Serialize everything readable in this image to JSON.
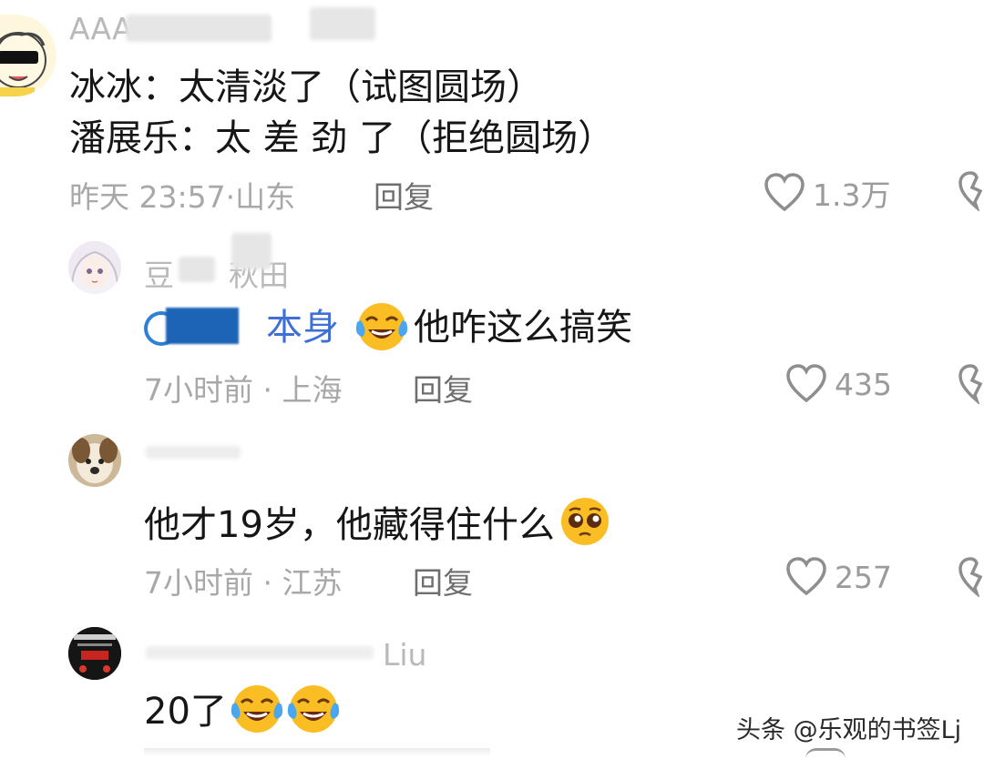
{
  "comments": [
    {
      "username": "AAA",
      "lines": [
        "冰冰：太清淡了（试图圆场）",
        "潘展乐：太 差 劲 了（拒绝圆场）"
      ],
      "time": "昨天 23:57",
      "location": "山东",
      "reply_label": "回复",
      "likes": "1.3万"
    },
    {
      "username": "豆",
      "username_tail": "秋田",
      "mention": "本身",
      "text": "他咋这么搞笑",
      "time": "7小时前",
      "location": "上海",
      "reply_label": "回复",
      "likes": "435"
    },
    {
      "username": "",
      "text": "他才19岁，他藏得住什么",
      "time": "7小时前",
      "location": "江苏",
      "reply_label": "回复",
      "likes": "257"
    },
    {
      "username_tail": "Liu",
      "text": "20了"
    }
  ],
  "separator": "·",
  "watermark": "头条 @乐观的书签Lj",
  "icons": {
    "like": "heart-outline-icon",
    "dislike": "broken-heart-icon",
    "laugh": "tears-of-joy-emoji",
    "pleading": "pleading-face-emoji"
  }
}
